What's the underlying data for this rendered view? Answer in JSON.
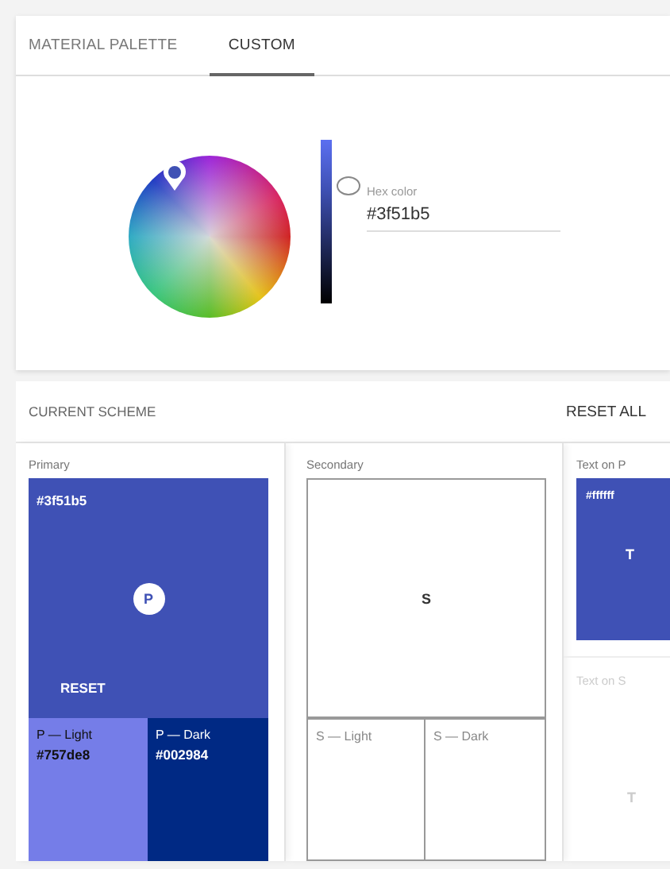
{
  "tabs": [
    {
      "label": "MATERIAL PALETTE",
      "selected": false
    },
    {
      "label": "CUSTOM",
      "selected": true
    }
  ],
  "picker": {
    "hex_label": "Hex color",
    "hex_value": "#3f51b5",
    "lightness": {
      "level": 0.72
    }
  },
  "scheme": {
    "title": "CURRENT SCHEME",
    "reset_all": "RESET ALL",
    "primary": {
      "label": "Primary",
      "hex": "#3f51b5",
      "color": "#3f51b5",
      "badge": "P",
      "reset": "RESET",
      "variants": [
        {
          "label": "P — Light",
          "hex": "#757de8",
          "color": "#757de8"
        },
        {
          "label": "P — Dark",
          "hex": "#002984",
          "color": "#002984"
        }
      ]
    },
    "secondary": {
      "label": "Secondary",
      "badge": "S",
      "variants": [
        {
          "label": "S — Light"
        },
        {
          "label": "S — Dark"
        }
      ]
    },
    "text_on_p": {
      "label": "Text on P",
      "hex": "#ffffff",
      "color": "#3f51b5",
      "letter": "T"
    },
    "text_on_s": {
      "label": "Text on S",
      "letter": "T"
    }
  }
}
